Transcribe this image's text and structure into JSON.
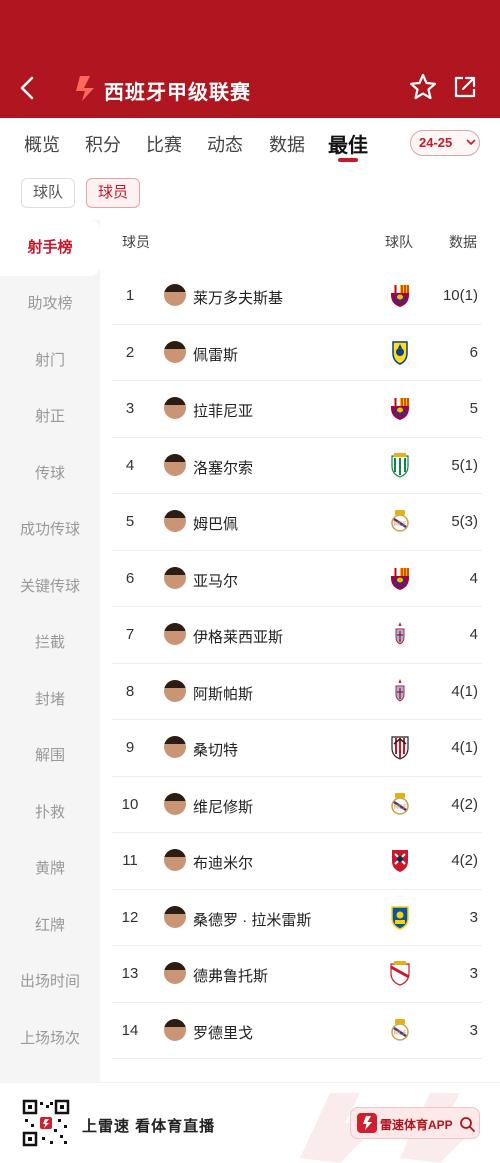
{
  "header": {
    "title": "西班牙甲级联赛"
  },
  "tabs": [
    "概览",
    "积分",
    "比赛",
    "动态",
    "数据",
    "最佳"
  ],
  "active_tab": "最佳",
  "season": "24-25",
  "filters": [
    "球队",
    "球员"
  ],
  "active_filter": "球员",
  "sidebar": [
    "射手榜",
    "助攻榜",
    "射门",
    "射正",
    "传球",
    "成功传球",
    "关键传球",
    "拦截",
    "封堵",
    "解围",
    "扑救",
    "黄牌",
    "红牌",
    "出场时间",
    "上场场次"
  ],
  "active_sidebar": "射手榜",
  "table": {
    "headers": {
      "player": "球员",
      "team": "球队",
      "stat": "数据"
    },
    "rows": [
      {
        "rank": "1",
        "name": "莱万多夫斯基",
        "team_badge": "barcelona-crest",
        "stat": "10(1)"
      },
      {
        "rank": "2",
        "name": "佩雷斯",
        "team_badge": "villarreal-crest",
        "stat": "6"
      },
      {
        "rank": "3",
        "name": "拉菲尼亚",
        "team_badge": "barcelona-crest",
        "stat": "5"
      },
      {
        "rank": "4",
        "name": "洛塞尔索",
        "team_badge": "real-betis-crest",
        "stat": "5(1)"
      },
      {
        "rank": "5",
        "name": "姆巴佩",
        "team_badge": "real-madrid-crest",
        "stat": "5(3)"
      },
      {
        "rank": "6",
        "name": "亚马尔",
        "team_badge": "barcelona-crest",
        "stat": "4"
      },
      {
        "rank": "7",
        "name": "伊格莱西亚斯",
        "team_badge": "celta-vigo-crest",
        "stat": "4"
      },
      {
        "rank": "8",
        "name": "阿斯帕斯",
        "team_badge": "celta-vigo-crest",
        "stat": "4(1)"
      },
      {
        "rank": "9",
        "name": "桑切特",
        "team_badge": "athletic-bilbao-crest",
        "stat": "4(1)"
      },
      {
        "rank": "10",
        "name": "维尼修斯",
        "team_badge": "real-madrid-crest",
        "stat": "4(2)"
      },
      {
        "rank": "11",
        "name": "布迪米尔",
        "team_badge": "osasuna-crest",
        "stat": "4(2)"
      },
      {
        "rank": "12",
        "name": "桑德罗 · 拉米雷斯",
        "team_badge": "las-palmas-crest",
        "stat": "3"
      },
      {
        "rank": "13",
        "name": "德弗鲁托斯",
        "team_badge": "rayo-vallecano-crest",
        "stat": "3"
      },
      {
        "rank": "14",
        "name": "罗德里戈",
        "team_badge": "real-madrid-crest",
        "stat": "3"
      }
    ]
  },
  "footer": {
    "slogan": "上雷速  看体育直播",
    "app_label": "雷速体育APP"
  },
  "colors": {
    "header_red": "#b0161f",
    "accent_red": "#c9182a",
    "sidebar_bg": "#f5f5f5"
  }
}
